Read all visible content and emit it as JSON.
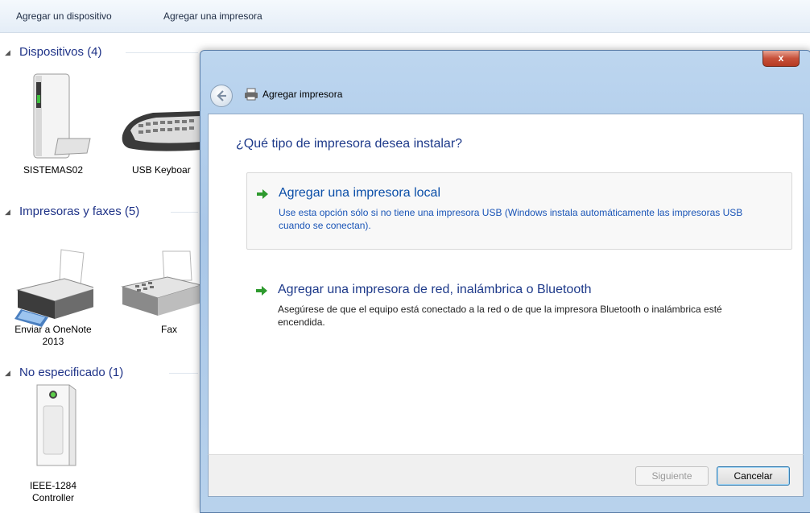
{
  "toolbar": {
    "add_device": "Agregar un dispositivo",
    "add_printer": "Agregar una impresora"
  },
  "groups": {
    "devices": {
      "title": "Dispositivos (4)",
      "items": [
        {
          "label": "SISTEMAS02",
          "icon": "tower-computer-icon"
        },
        {
          "label": "USB Keyboar",
          "icon": "keyboard-icon"
        }
      ]
    },
    "printers": {
      "title": "Impresoras y faxes (5)",
      "items": [
        {
          "label": "Enviar a OneNote 2013",
          "icon": "printer-icon"
        },
        {
          "label": "Fax",
          "icon": "fax-icon"
        }
      ]
    },
    "unspecified": {
      "title": "No especificado (1)",
      "items": [
        {
          "label": "IEEE-1284 Controller",
          "icon": "controller-device-icon"
        }
      ]
    }
  },
  "dialog": {
    "close_label": "x",
    "title": "Agregar impresora",
    "heading": "¿Qué tipo de impresora desea instalar?",
    "options": [
      {
        "title": "Agregar una impresora local",
        "description": "Use esta opción sólo si no tiene una impresora USB (Windows instala automáticamente las impresoras USB cuando se conectan)."
      },
      {
        "title": "Agregar una impresora de red, inalámbrica o Bluetooth",
        "description": "Asegúrese de que el equipo está conectado a la red o de que la impresora Bluetooth o inalámbrica esté encendida."
      }
    ],
    "next_button": "Siguiente",
    "cancel_button": "Cancelar"
  },
  "colors": {
    "link_blue": "#1a55b7",
    "heading_blue": "#1e3a8a",
    "arrow_green": "#2e9a2e"
  }
}
